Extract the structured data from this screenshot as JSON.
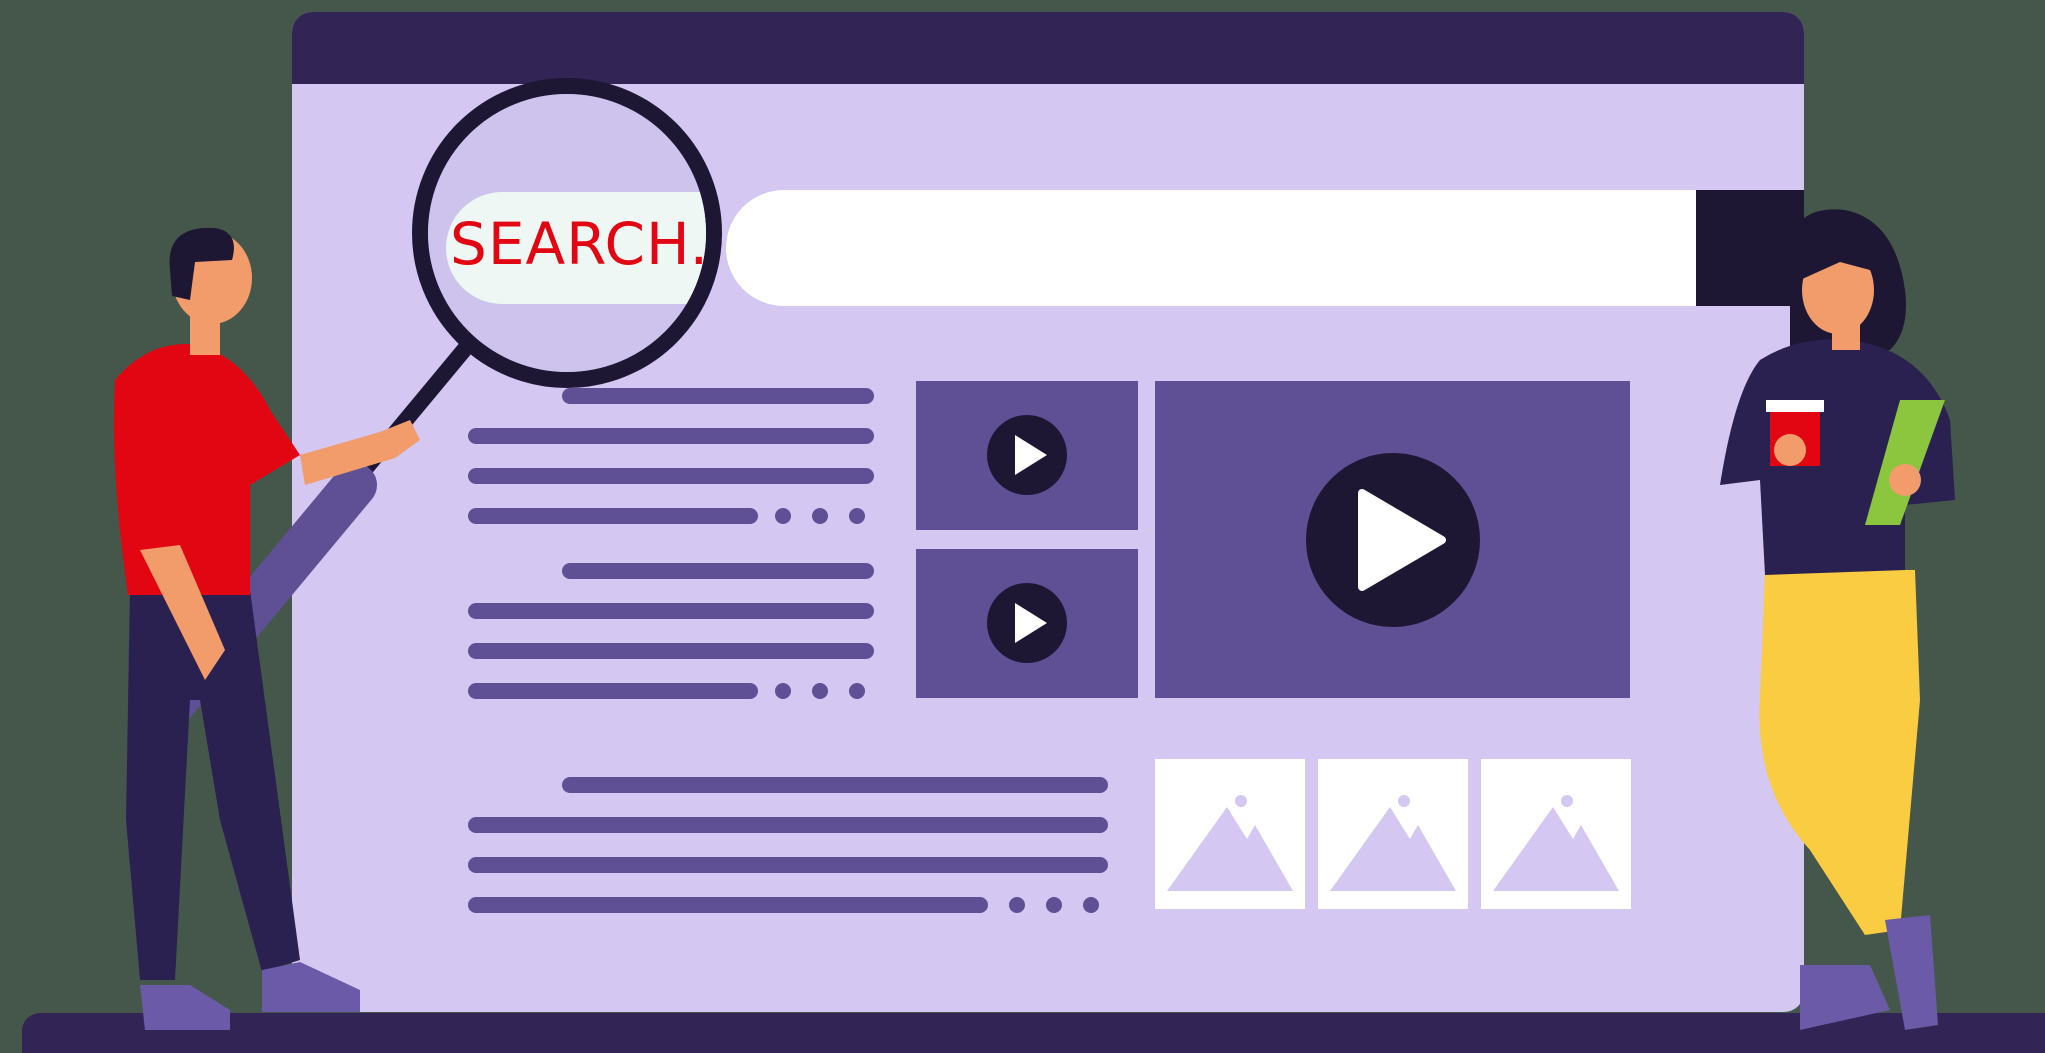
{
  "illustration": {
    "search_text": "SEARCH..",
    "colors": {
      "background": "#45574a",
      "browser_bg": "#d4c7f1",
      "browser_frame": "#322555",
      "accent_purple": "#5f5096",
      "dark": "#1d1734",
      "search_text_color": "#e20613"
    },
    "icons": [
      "search-icon",
      "play-icon",
      "image-icon",
      "magnifying-glass"
    ],
    "video_thumbnails": 3,
    "image_thumbnails": 3
  }
}
